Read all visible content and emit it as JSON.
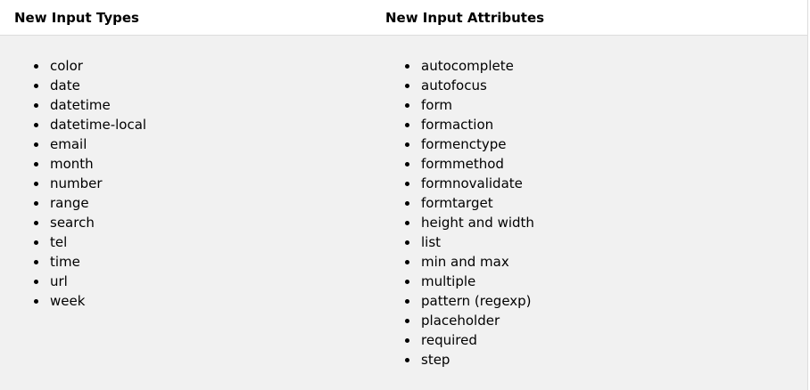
{
  "headers": {
    "types": "New Input Types",
    "attributes": "New Input Attributes"
  },
  "types": [
    "color",
    "date",
    "datetime",
    "datetime-local",
    "email",
    "month",
    "number",
    "range",
    "search",
    "tel",
    "time",
    "url",
    "week"
  ],
  "attributes": [
    "autocomplete",
    "autofocus",
    "form",
    "formaction",
    "formenctype",
    "formmethod",
    "formnovalidate",
    "formtarget",
    "height and width",
    "list",
    "min and max",
    "multiple",
    "pattern (regexp)",
    "placeholder",
    "required",
    "step"
  ],
  "colors": {
    "header_bg": "#ffffff",
    "body_bg": "#f1f1f1",
    "border": "#dddddd",
    "text": "#000000"
  }
}
